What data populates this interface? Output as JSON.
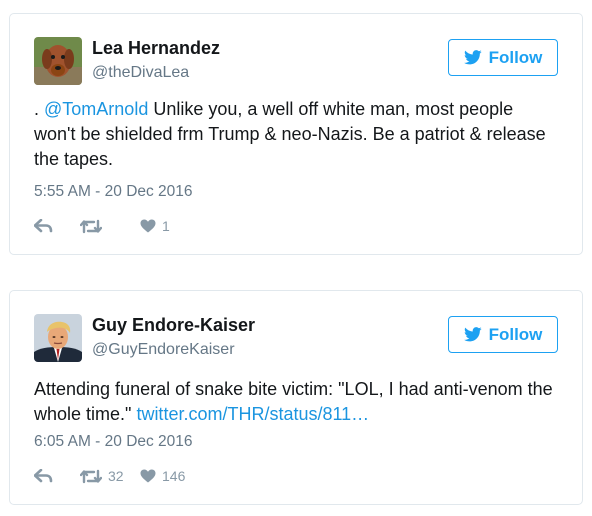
{
  "follow_label": "Follow",
  "colors": {
    "accent": "#1da1f2",
    "link": "#1b95e0",
    "muted": "#657786",
    "icon": "#8899a6",
    "border": "#e1e8ed"
  },
  "icons": {
    "follow": "twitter-bird-icon",
    "reply": "reply-arrow-icon",
    "retweet": "retweet-icon",
    "like": "heart-icon"
  },
  "tweets": [
    {
      "name": "Lea Hernandez",
      "handle": "@theDivaLea",
      "text_prefix": ". ",
      "mention": "@TomArnold",
      "text_body": " Unlike you, a well off white man, most people won't be shielded frm Trump & neo-Nazis. Be a patriot & release the tapes.",
      "timestamp": "5:55 AM - 20 Dec 2016",
      "retweets": "",
      "likes": "1"
    },
    {
      "name": "Guy Endore-Kaiser",
      "handle": "@GuyEndoreKaiser",
      "text_body": "Attending funeral of snake bite victim: \"LOL, I had anti-venom the whole time.\" ",
      "link": "twitter.com/THR/status/811…",
      "timestamp": "6:05 AM - 20 Dec 2016",
      "retweets": "32",
      "likes": "146"
    }
  ]
}
